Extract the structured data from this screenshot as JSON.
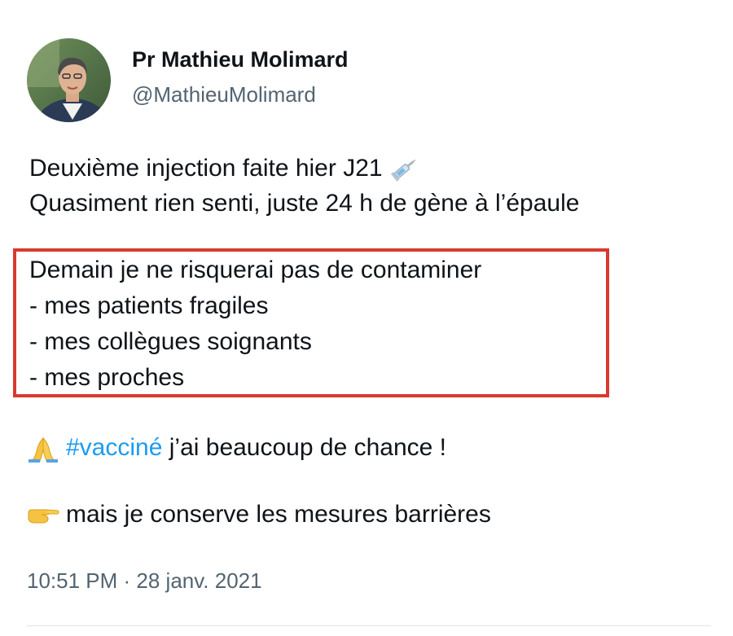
{
  "author": {
    "display_name": "Pr Mathieu Molimard",
    "handle": "@MathieuMolimard",
    "avatar_icon": "person-photo"
  },
  "tweet": {
    "line1": "Deuxième injection faite hier J21",
    "line1_icon": "syringe-icon",
    "line2": "Quasiment rien senti, juste 24 h de gène à l’épaule",
    "highlighted_lines": [
      "Demain je ne risquerai pas de contaminer",
      "- mes patients fragiles",
      "- mes collègues soignants",
      "- mes proches"
    ],
    "line3_icon": "folded-hands-icon",
    "hashtag": "#vacciné",
    "line3_rest": " j’ai beaucoup de chance !",
    "line4_icon": "pointing-hand-icon",
    "line4": "mais je conserve les mesures barrières"
  },
  "timestamp": "10:51 PM · 28 janv. 2021",
  "colors": {
    "highlight_border": "#d9392e",
    "hashtag": "#1d9bf0",
    "secondary_text": "#536471"
  }
}
